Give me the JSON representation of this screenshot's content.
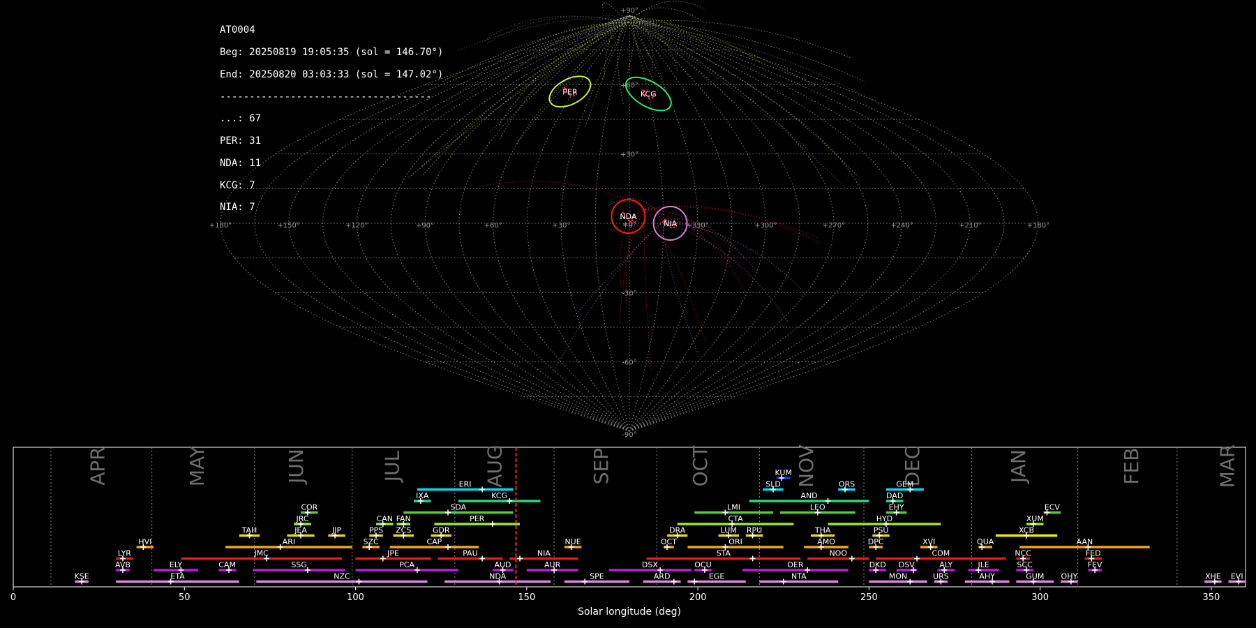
{
  "info": {
    "id": "AT0004",
    "beg": "Beg: 20250819 19:05:35 (sol = 146.70°)",
    "end": "End: 20250820 03:03:33 (sol = 147.02°)",
    "rule": "------------------------------------",
    "counts": [
      "...: 67",
      "PER: 31",
      "NDA: 11",
      "KCG: 7",
      "NIA: 7"
    ]
  },
  "sky_map": {
    "projection": "sinusoidal",
    "lat_labels": [
      "+90°",
      "+60°",
      "+30°",
      "+0°",
      "-30°",
      "-60°",
      "-90°"
    ],
    "lon_labels": [
      "+180°",
      "+150°",
      "+120°",
      "+90°",
      "+60°",
      "+30°",
      "+0°",
      "+330°",
      "+300°",
      "+270°",
      "+240°",
      "+210°",
      "+180°"
    ],
    "radiants": [
      {
        "name": "PER",
        "lon": 48,
        "lat": 57,
        "color": "#c8f53c"
      },
      {
        "name": "KCG",
        "lon": 345,
        "lat": 56,
        "color": "#2ee86a"
      },
      {
        "name": "NDA",
        "lon": 0.5,
        "lat": 3,
        "color": "#ff1a1a"
      },
      {
        "name": "NIA",
        "lon": 342,
        "lat": 0,
        "color": "#e07ad8"
      }
    ]
  },
  "chart_data": {
    "type": "timeline",
    "xlabel": "Solar longitude (deg)",
    "xlim": [
      0,
      360
    ],
    "xticks": [
      0,
      50,
      100,
      150,
      200,
      250,
      300,
      350
    ],
    "current_sol": 146.86,
    "month_boundaries": [
      11,
      40.5,
      70.5,
      99,
      129,
      158,
      188,
      218,
      248.5,
      280,
      311,
      340
    ],
    "months": [
      {
        "label": "APR",
        "x": 25
      },
      {
        "label": "MAY",
        "x": 54
      },
      {
        "label": "JUN",
        "x": 83
      },
      {
        "label": "JUL",
        "x": 111
      },
      {
        "label": "AUG",
        "x": 141
      },
      {
        "label": "SEP",
        "x": 172
      },
      {
        "label": "OCT",
        "x": 201
      },
      {
        "label": "NOV",
        "x": 232
      },
      {
        "label": "DEC",
        "x": 263
      },
      {
        "label": "JAN",
        "x": 294
      },
      {
        "label": "FEB",
        "x": 327
      },
      {
        "label": "MAR",
        "x": 355
      }
    ],
    "showers": [
      {
        "code": "KUM",
        "start": 223,
        "end": 227,
        "peak": 224.5,
        "row": 10,
        "color": "#2233ff"
      },
      {
        "code": "ERI",
        "start": 118,
        "end": 146,
        "peak": 137,
        "row": 9,
        "color": "#16d4f0"
      },
      {
        "code": "SLD",
        "start": 219,
        "end": 225,
        "peak": 222,
        "row": 9,
        "color": "#16d4f0"
      },
      {
        "code": "ORS",
        "start": 241,
        "end": 246,
        "peak": 243,
        "row": 9,
        "color": "#16d4f0"
      },
      {
        "code": "GEM",
        "start": 255,
        "end": 266,
        "peak": 262,
        "row": 9,
        "color": "#16d4f0"
      },
      {
        "code": "IXA",
        "start": 117,
        "end": 122,
        "peak": 119,
        "row": 8,
        "color": "#1fdc84"
      },
      {
        "code": "KCG",
        "start": 130,
        "end": 154,
        "peak": 145,
        "row": 8,
        "color": "#1fdc84"
      },
      {
        "code": "AND",
        "start": 215,
        "end": 250,
        "peak": 238,
        "row": 8,
        "color": "#1fdc84"
      },
      {
        "code": "DAD",
        "start": 255,
        "end": 260,
        "peak": 257,
        "row": 8,
        "color": "#1fdc84"
      },
      {
        "code": "COR",
        "start": 84,
        "end": 89,
        "peak": 86,
        "row": 7,
        "color": "#52cf32"
      },
      {
        "code": "SDA",
        "start": 114,
        "end": 146,
        "peak": 127,
        "row": 7,
        "color": "#52cf32"
      },
      {
        "code": "LMI",
        "start": 199,
        "end": 222,
        "peak": 208,
        "row": 7,
        "color": "#52cf32"
      },
      {
        "code": "LEO",
        "start": 224,
        "end": 246,
        "peak": 235,
        "row": 7,
        "color": "#52cf32"
      },
      {
        "code": "EHY",
        "start": 255,
        "end": 261,
        "peak": 258,
        "row": 7,
        "color": "#52cf32"
      },
      {
        "code": "ECV",
        "start": 301,
        "end": 306,
        "peak": 302,
        "row": 7,
        "color": "#52cf32"
      },
      {
        "code": "JRC",
        "start": 82,
        "end": 87,
        "peak": 84,
        "row": 6,
        "color": "#9be83a"
      },
      {
        "code": "CAN",
        "start": 106,
        "end": 111,
        "peak": 108,
        "row": 6,
        "color": "#9be83a"
      },
      {
        "code": "FAN",
        "start": 112,
        "end": 116,
        "peak": 114,
        "row": 6,
        "color": "#9be83a"
      },
      {
        "code": "PER",
        "start": 123,
        "end": 148,
        "peak": 140,
        "row": 6,
        "color": "#9be83a"
      },
      {
        "code": "CTA",
        "start": 194,
        "end": 228,
        "peak": 210,
        "row": 6,
        "color": "#9be83a"
      },
      {
        "code": "HYD",
        "start": 238,
        "end": 271,
        "peak": 255,
        "row": 6,
        "color": "#9be83a"
      },
      {
        "code": "XUM",
        "start": 296,
        "end": 301,
        "peak": 298,
        "row": 6,
        "color": "#9be83a"
      },
      {
        "code": "TAH",
        "start": 66,
        "end": 72,
        "peak": 69,
        "row": 5,
        "color": "#e2d22a"
      },
      {
        "code": "JEA",
        "start": 80,
        "end": 88,
        "peak": 84,
        "row": 5,
        "color": "#e2d22a"
      },
      {
        "code": "JIP",
        "start": 92,
        "end": 97,
        "peak": 94,
        "row": 5,
        "color": "#e2d22a"
      },
      {
        "code": "PPS",
        "start": 104,
        "end": 108,
        "peak": 106,
        "row": 5,
        "color": "#e2d22a"
      },
      {
        "code": "ZCS",
        "start": 111,
        "end": 117,
        "peak": 114,
        "row": 5,
        "color": "#e2d22a"
      },
      {
        "code": "GDR",
        "start": 122,
        "end": 128,
        "peak": 125,
        "row": 5,
        "color": "#e2d22a"
      },
      {
        "code": "DRA",
        "start": 191,
        "end": 197,
        "peak": 194,
        "row": 5,
        "color": "#e2d22a"
      },
      {
        "code": "LUM",
        "start": 206,
        "end": 212,
        "peak": 209,
        "row": 5,
        "color": "#e2d22a"
      },
      {
        "code": "RPU",
        "start": 214,
        "end": 219,
        "peak": 216,
        "row": 5,
        "color": "#e2d22a"
      },
      {
        "code": "THA",
        "start": 233,
        "end": 240,
        "peak": 236,
        "row": 5,
        "color": "#e2d22a"
      },
      {
        "code": "PSU",
        "start": 251,
        "end": 256,
        "peak": 253,
        "row": 5,
        "color": "#e2d22a"
      },
      {
        "code": "XCB",
        "start": 287,
        "end": 305,
        "peak": 296,
        "row": 5,
        "color": "#f5e615"
      },
      {
        "code": "HVI",
        "start": 36,
        "end": 41,
        "peak": 38,
        "row": 4,
        "color": "#f5a416"
      },
      {
        "code": "ARI",
        "start": 62,
        "end": 99,
        "peak": 78,
        "row": 4,
        "color": "#f5a416"
      },
      {
        "code": "SZC",
        "start": 102,
        "end": 107,
        "peak": 104,
        "row": 4,
        "color": "#f5a416"
      },
      {
        "code": "CAP",
        "start": 110,
        "end": 136,
        "peak": 127,
        "row": 4,
        "color": "#f5a416"
      },
      {
        "code": "NUE",
        "start": 161,
        "end": 166,
        "peak": 163,
        "row": 4,
        "color": "#f5a416"
      },
      {
        "code": "OCT",
        "start": 190,
        "end": 193,
        "peak": 191,
        "row": 4,
        "color": "#f5a416"
      },
      {
        "code": "ORI",
        "start": 197,
        "end": 225,
        "peak": 208,
        "row": 4,
        "color": "#f5a416"
      },
      {
        "code": "AMO",
        "start": 231,
        "end": 244,
        "peak": 236,
        "row": 4,
        "color": "#f5a416"
      },
      {
        "code": "DPC",
        "start": 250,
        "end": 254,
        "peak": 252,
        "row": 4,
        "color": "#f5a416"
      },
      {
        "code": "XVI",
        "start": 265,
        "end": 270,
        "peak": 268,
        "row": 4,
        "color": "#f5a416"
      },
      {
        "code": "QUA",
        "start": 282,
        "end": 286,
        "peak": 283,
        "row": 4,
        "color": "#f5a416"
      },
      {
        "code": "AAN",
        "start": 294,
        "end": 332,
        "peak": 314,
        "row": 4,
        "color": "#f5a416"
      },
      {
        "code": "LYR",
        "start": 30,
        "end": 35,
        "peak": 32,
        "row": 3,
        "color": "#e81a1a"
      },
      {
        "code": "JMC",
        "start": 49,
        "end": 96,
        "peak": 74,
        "row": 3,
        "color": "#e81a1a"
      },
      {
        "code": "JPE",
        "start": 100,
        "end": 122,
        "peak": 108,
        "row": 3,
        "color": "#e81a1a"
      },
      {
        "code": "PAU",
        "start": 124,
        "end": 143,
        "peak": 137,
        "row": 3,
        "color": "#e81a1a"
      },
      {
        "code": "NIA",
        "start": 145,
        "end": 165,
        "peak": 148,
        "row": 3,
        "color": "#e81a1a"
      },
      {
        "code": "STA",
        "start": 185,
        "end": 230,
        "peak": 216,
        "row": 3,
        "color": "#e81a1a"
      },
      {
        "code": "NOO",
        "start": 232,
        "end": 250,
        "peak": 245,
        "row": 3,
        "color": "#e81a1a"
      },
      {
        "code": "COM",
        "start": 252,
        "end": 290,
        "peak": 264,
        "row": 3,
        "color": "#e81a1a"
      },
      {
        "code": "NCC",
        "start": 293,
        "end": 297,
        "peak": 295,
        "row": 3,
        "color": "#e81a1a"
      },
      {
        "code": "FED",
        "start": 313,
        "end": 318,
        "peak": 315,
        "row": 3,
        "color": "#e81a1a"
      },
      {
        "code": "AVB",
        "start": 30,
        "end": 34,
        "peak": 32,
        "row": 2,
        "color": "#bf1ad9"
      },
      {
        "code": "ELY",
        "start": 41,
        "end": 54,
        "peak": 49,
        "row": 2,
        "color": "#bf1ad9"
      },
      {
        "code": "CAM",
        "start": 60,
        "end": 65,
        "peak": 63,
        "row": 2,
        "color": "#bf1ad9"
      },
      {
        "code": "SSG",
        "start": 70,
        "end": 97,
        "peak": 86,
        "row": 2,
        "color": "#bf1ad9"
      },
      {
        "code": "PCA",
        "start": 100,
        "end": 130,
        "peak": 118,
        "row": 2,
        "color": "#bf1ad9"
      },
      {
        "code": "AUD",
        "start": 140,
        "end": 146,
        "peak": 143,
        "row": 2,
        "color": "#bf1ad9"
      },
      {
        "code": "AUR",
        "start": 150,
        "end": 165,
        "peak": 158,
        "row": 2,
        "color": "#bf1ad9"
      },
      {
        "code": "DSX",
        "start": 174,
        "end": 198,
        "peak": 189,
        "row": 2,
        "color": "#bf1ad9"
      },
      {
        "code": "OCU",
        "start": 199,
        "end": 204,
        "peak": 202,
        "row": 2,
        "color": "#bf1ad9"
      },
      {
        "code": "OER",
        "start": 213,
        "end": 244,
        "peak": 232,
        "row": 2,
        "color": "#bf1ad9"
      },
      {
        "code": "DKD",
        "start": 250,
        "end": 255,
        "peak": 252,
        "row": 2,
        "color": "#bf1ad9"
      },
      {
        "code": "DSV",
        "start": 258,
        "end": 264,
        "peak": 263,
        "row": 2,
        "color": "#bf1ad9"
      },
      {
        "code": "ALY",
        "start": 270,
        "end": 275,
        "peak": 272,
        "row": 2,
        "color": "#bf1ad9"
      },
      {
        "code": "ILE",
        "start": 279,
        "end": 288,
        "peak": 282,
        "row": 2,
        "color": "#bf1ad9"
      },
      {
        "code": "SCC",
        "start": 293,
        "end": 298,
        "peak": 296,
        "row": 2,
        "color": "#bf1ad9"
      },
      {
        "code": "FEV",
        "start": 314,
        "end": 318,
        "peak": 316,
        "row": 2,
        "color": "#bf1ad9"
      },
      {
        "code": "KSE",
        "start": 18,
        "end": 22,
        "peak": 20,
        "row": 1,
        "color": "#dd88dd"
      },
      {
        "code": "ETA",
        "start": 30,
        "end": 66,
        "peak": 46,
        "row": 1,
        "color": "#dd88dd"
      },
      {
        "code": "NZC",
        "start": 71,
        "end": 121,
        "peak": 101,
        "row": 1,
        "color": "#dd88dd"
      },
      {
        "code": "NDA",
        "start": 126,
        "end": 157,
        "peak": 142,
        "row": 1,
        "color": "#dd88dd"
      },
      {
        "code": "SPE",
        "start": 161,
        "end": 180,
        "peak": 167,
        "row": 1,
        "color": "#dd88dd"
      },
      {
        "code": "ARD",
        "start": 184,
        "end": 195,
        "peak": 193,
        "row": 1,
        "color": "#dd88dd"
      },
      {
        "code": "EGE",
        "start": 197,
        "end": 214,
        "peak": 199,
        "row": 1,
        "color": "#dd88dd"
      },
      {
        "code": "NTA",
        "start": 218,
        "end": 241,
        "peak": 225,
        "row": 1,
        "color": "#dd88dd"
      },
      {
        "code": "MON",
        "start": 250,
        "end": 267,
        "peak": 262,
        "row": 1,
        "color": "#dd88dd"
      },
      {
        "code": "URS",
        "start": 269,
        "end": 273,
        "peak": 271,
        "row": 1,
        "color": "#dd88dd"
      },
      {
        "code": "AHY",
        "start": 278,
        "end": 291,
        "peak": 286,
        "row": 1,
        "color": "#dd88dd"
      },
      {
        "code": "GUM",
        "start": 293,
        "end": 304,
        "peak": 298,
        "row": 1,
        "color": "#dd88dd"
      },
      {
        "code": "OHY",
        "start": 306,
        "end": 311,
        "peak": 309,
        "row": 1,
        "color": "#dd88dd"
      },
      {
        "code": "XHE",
        "start": 348,
        "end": 353,
        "peak": 351,
        "row": 1,
        "color": "#dd88dd"
      },
      {
        "code": "EVI",
        "start": 355,
        "end": 360,
        "peak": 358,
        "row": 1,
        "color": "#dd88dd"
      }
    ]
  }
}
